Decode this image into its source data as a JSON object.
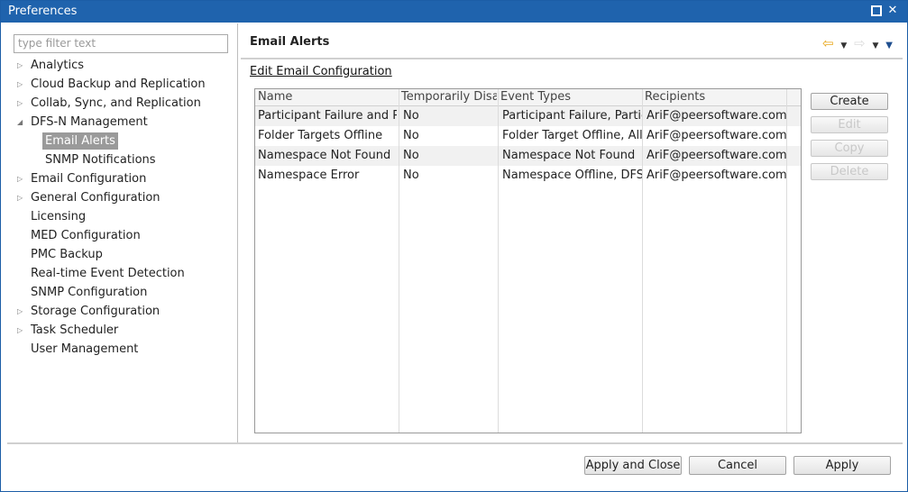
{
  "window": {
    "title": "Preferences"
  },
  "filter": {
    "placeholder": "type filter text"
  },
  "tree": {
    "items": [
      {
        "label": "Analytics",
        "expandable": true
      },
      {
        "label": "Cloud Backup and Replication",
        "expandable": true
      },
      {
        "label": "Collab, Sync, and Replication",
        "expandable": true
      },
      {
        "label": "DFS-N Management",
        "expandable": true,
        "expanded": true
      },
      {
        "label": "Email Alerts",
        "child": true,
        "selected": true
      },
      {
        "label": "SNMP Notifications",
        "child": true
      },
      {
        "label": "Email Configuration",
        "expandable": true
      },
      {
        "label": "General Configuration",
        "expandable": true
      },
      {
        "label": "Licensing"
      },
      {
        "label": "MED Configuration"
      },
      {
        "label": "PMC Backup"
      },
      {
        "label": "Real-time Event Detection"
      },
      {
        "label": "SNMP Configuration"
      },
      {
        "label": "Storage Configuration",
        "expandable": true
      },
      {
        "label": "Task Scheduler",
        "expandable": true
      },
      {
        "label": "User Management"
      }
    ]
  },
  "page": {
    "title": "Email Alerts",
    "edit_link": "Edit Email Configuration"
  },
  "table": {
    "columns": [
      "Name",
      "Temporarily Disabled",
      "Event Types",
      "Recipients"
    ],
    "rows": [
      [
        "Participant Failure and Pa",
        "No",
        "Participant Failure, Partici",
        "AriF@peersoftware.com"
      ],
      [
        "Folder Targets Offline",
        "No",
        "Folder Target Offline, All F",
        "AriF@peersoftware.com"
      ],
      [
        "Namespace Not Found",
        "No",
        "Namespace Not Found",
        "AriF@peersoftware.com"
      ],
      [
        "Namespace Error",
        "No",
        "Namespace Offline, DFS S",
        "AriF@peersoftware.com"
      ]
    ]
  },
  "side_buttons": {
    "create": "Create",
    "edit": "Edit",
    "copy": "Copy",
    "delete": "Delete"
  },
  "bottom_buttons": {
    "apply_close": "Apply and Close",
    "cancel": "Cancel",
    "apply": "Apply"
  },
  "colors": {
    "titlebar": "#1f63ad",
    "selection": "#9a9a9a",
    "back_arrow": "#e8a617"
  }
}
